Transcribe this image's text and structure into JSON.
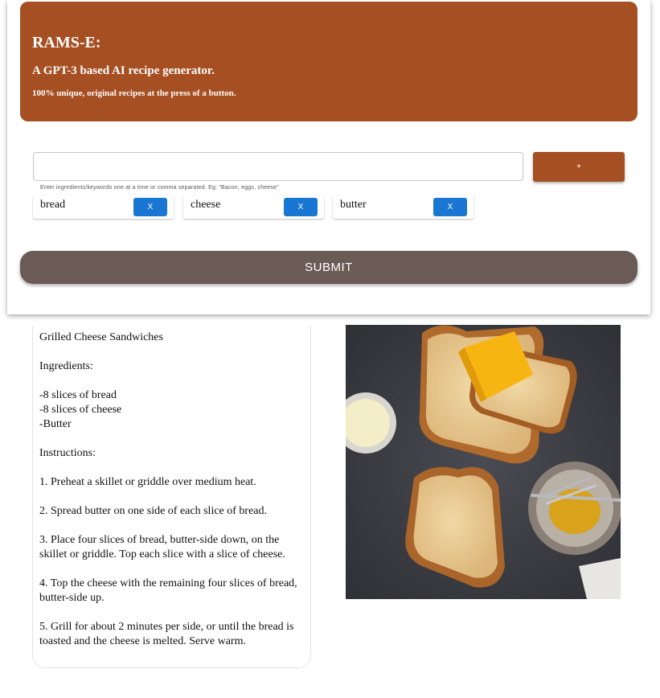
{
  "header": {
    "title": "RAMS-E:",
    "subtitle": "A GPT-3 based AI recipe generator.",
    "tagline": "100% unique, original recipes at the press of a button."
  },
  "ingredient_input": {
    "value": "",
    "hint": "Enter ingredients/keywords one at a time or comma separated. Eg: \"Bacon, eggs, cheese\"",
    "add_label": "+"
  },
  "chips": [
    {
      "label": "bread",
      "remove_label": "X"
    },
    {
      "label": "cheese",
      "remove_label": "X"
    },
    {
      "label": "butter",
      "remove_label": "X"
    }
  ],
  "submit_label": "SUBMIT",
  "recipe": {
    "title": "Grilled Cheese Sandwiches",
    "ingredients_heading": "Ingredients:",
    "ingredients": [
      "-8 slices of bread",
      "-8 slices of cheese",
      "-Butter"
    ],
    "instructions_heading": "Instructions:",
    "steps": [
      "1. Preheat a skillet or griddle over medium heat.",
      "2. Spread butter on one side of each slice of bread.",
      "3. Place four slices of bread, butter-side down, on the skillet or griddle. Top each slice with a slice of cheese.",
      "4. Top the cheese with the remaining four slices of bread, butter-side up.",
      "5. Grill for about 2 minutes per side, or until the bread is toasted and the cheese is melted. Serve warm."
    ]
  },
  "colors": {
    "brand": "#a64f22",
    "submit": "#6a5b56",
    "chip_button": "#1976d2"
  }
}
